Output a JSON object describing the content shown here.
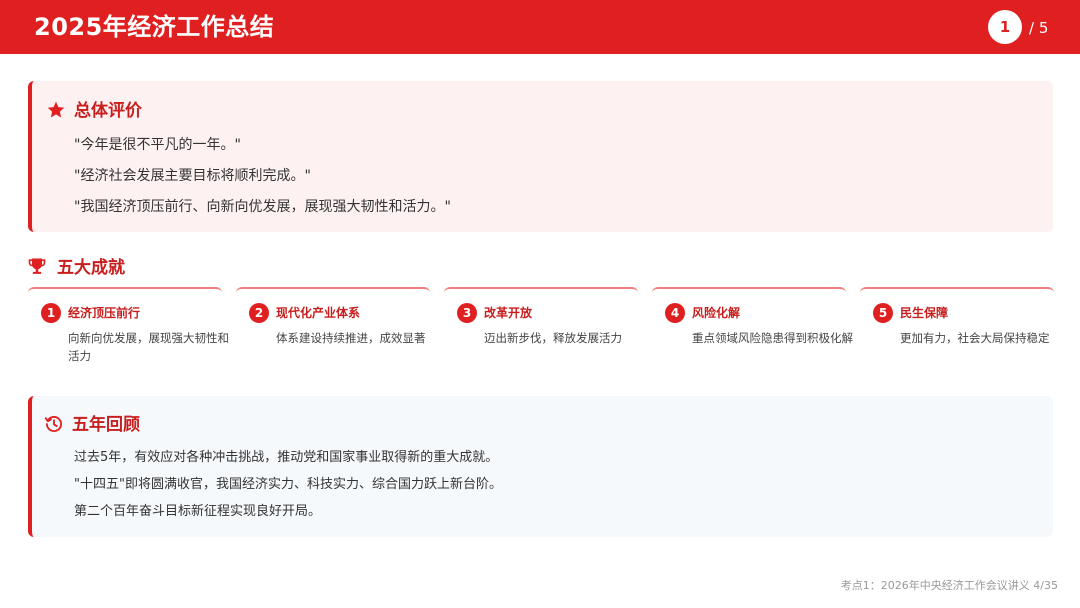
{
  "header": {
    "title": "2025年经济工作总结",
    "page_current": "1",
    "page_total": "/ 5"
  },
  "overall": {
    "title": "总体评价",
    "icon": "star-icon",
    "quotes": [
      "\"今年是很不平凡的一年。\"",
      "\"经济社会发展主要目标将顺利完成。\"",
      "\"我国经济顶压前行、向新向优发展，展现强大韧性和活力。\""
    ]
  },
  "achievements": {
    "title": "五大成就",
    "icon": "trophy-icon",
    "items": [
      {
        "num": "1",
        "title": "经济顶压前行",
        "desc": "向新向优发展，展现强大韧性和活力"
      },
      {
        "num": "2",
        "title": "现代化产业体系",
        "desc": "体系建设持续推进，成效显著"
      },
      {
        "num": "3",
        "title": "改革开放",
        "desc": "迈出新步伐，释放发展活力"
      },
      {
        "num": "4",
        "title": "风险化解",
        "desc": "重点领域风险隐患得到积极化解"
      },
      {
        "num": "5",
        "title": "民生保障",
        "desc": "更加有力，社会大局保持稳定"
      }
    ]
  },
  "review": {
    "title": "五年回顾",
    "icon": "history-icon",
    "lines": [
      "过去5年，有效应对各种冲击挑战，推动党和国家事业取得新的重大成就。",
      "\"十四五\"即将圆满收官，我国经济实力、科技实力、综合国力跃上新台阶。",
      "第二个百年奋斗目标新征程实现良好开局。"
    ]
  },
  "footer": {
    "text": "考点1：2026年中央经济工作会议讲义  4/35"
  },
  "colors": {
    "accent": "#e02020",
    "title_red": "#c81e1e",
    "pink_bg": "#fef1f1",
    "blue_bg": "#f6f9fc"
  }
}
